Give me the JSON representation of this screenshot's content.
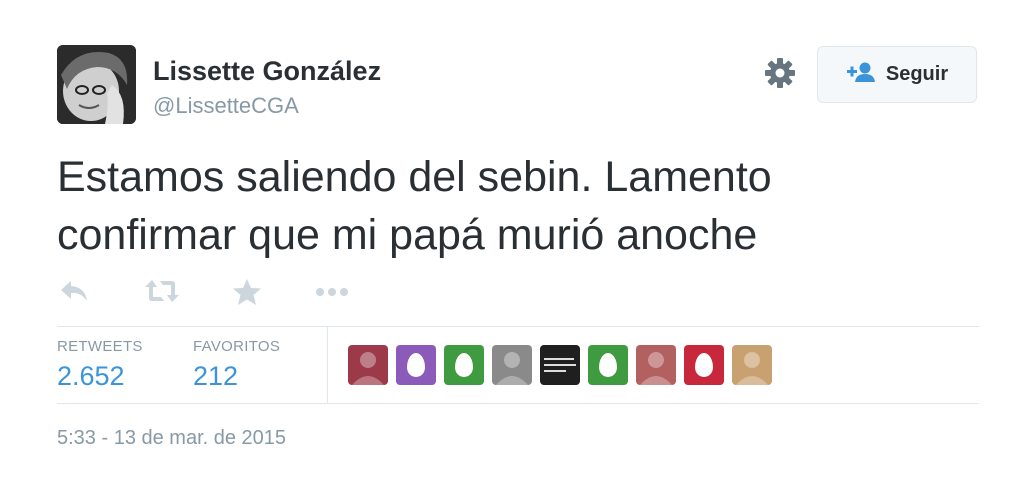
{
  "user": {
    "name": "Lissette González",
    "handle": "@LissetteCGA"
  },
  "header": {
    "follow_label": "Seguir",
    "settings_icon": "gear-icon",
    "follow_icon": "add-user-icon"
  },
  "tweet": {
    "text_line1": "Estamos saliendo del sebin. Lamento",
    "text_line2": "confirmar que mi papá murió anoche"
  },
  "actions": [
    {
      "icon": "reply-icon"
    },
    {
      "icon": "retweet-icon"
    },
    {
      "icon": "favorite-star-icon"
    },
    {
      "icon": "more-dots-icon"
    }
  ],
  "stats": {
    "retweets_label": "RETWEETS",
    "retweets_value": "2.652",
    "favorites_label": "FAVORITOS",
    "favorites_value": "212"
  },
  "favoriters": [
    {
      "kind": "photo",
      "color": "#9c3a4a"
    },
    {
      "kind": "egg",
      "color": "#8c5ab8"
    },
    {
      "kind": "egg",
      "color": "#3f9b3f"
    },
    {
      "kind": "photo",
      "color": "#8a8a8a"
    },
    {
      "kind": "text-image",
      "color": "#1f1f1f"
    },
    {
      "kind": "egg",
      "color": "#3f9b3f"
    },
    {
      "kind": "photo",
      "color": "#b36060"
    },
    {
      "kind": "egg",
      "color": "#c8283c"
    },
    {
      "kind": "photo",
      "color": "#c9a070"
    }
  ],
  "timestamp": "5:33 - 13 de mar. de 2015",
  "colors": {
    "link_blue": "#3b94d9",
    "muted": "#8899a6",
    "text": "#292f33",
    "border": "#e1e8ed"
  }
}
